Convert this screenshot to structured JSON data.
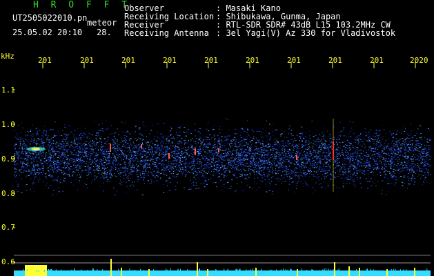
{
  "header": {
    "title": "H R O F F T",
    "filename": "UT2505022010.pn",
    "mode": "meteor",
    "datetime": "25.05.02 20:10",
    "counter": "28.",
    "fields": [
      {
        "label": "Observer",
        "value": ": Masaki Kano"
      },
      {
        "label": "Receiving Location",
        "value": ": Shibukawa, Gunma, Japan"
      },
      {
        "label": "Receiver",
        "value": ": RTL-SDR SDR# 43dB L15 103.2MHz CW"
      },
      {
        "label": "Receiving Antenna",
        "value": ": 3el Yagi(V) Az 330 for Vladivostok"
      }
    ]
  },
  "axes": {
    "y_unit": "kHz",
    "y_ticks": [
      "1.1",
      "1.0",
      "0.9",
      "0.8",
      "0.7",
      "0.6"
    ],
    "x_ticks": [
      "201",
      "201",
      "201",
      "201",
      "201",
      "201",
      "201",
      "201",
      "201",
      "2020"
    ]
  },
  "colors": {
    "background": "#000000",
    "label": "#ffff33",
    "title": "#34d934",
    "text": "#ffffff",
    "noise_band": "#0d2bd8",
    "signal": "#e8e84a",
    "baseline": "#33ddff"
  }
}
